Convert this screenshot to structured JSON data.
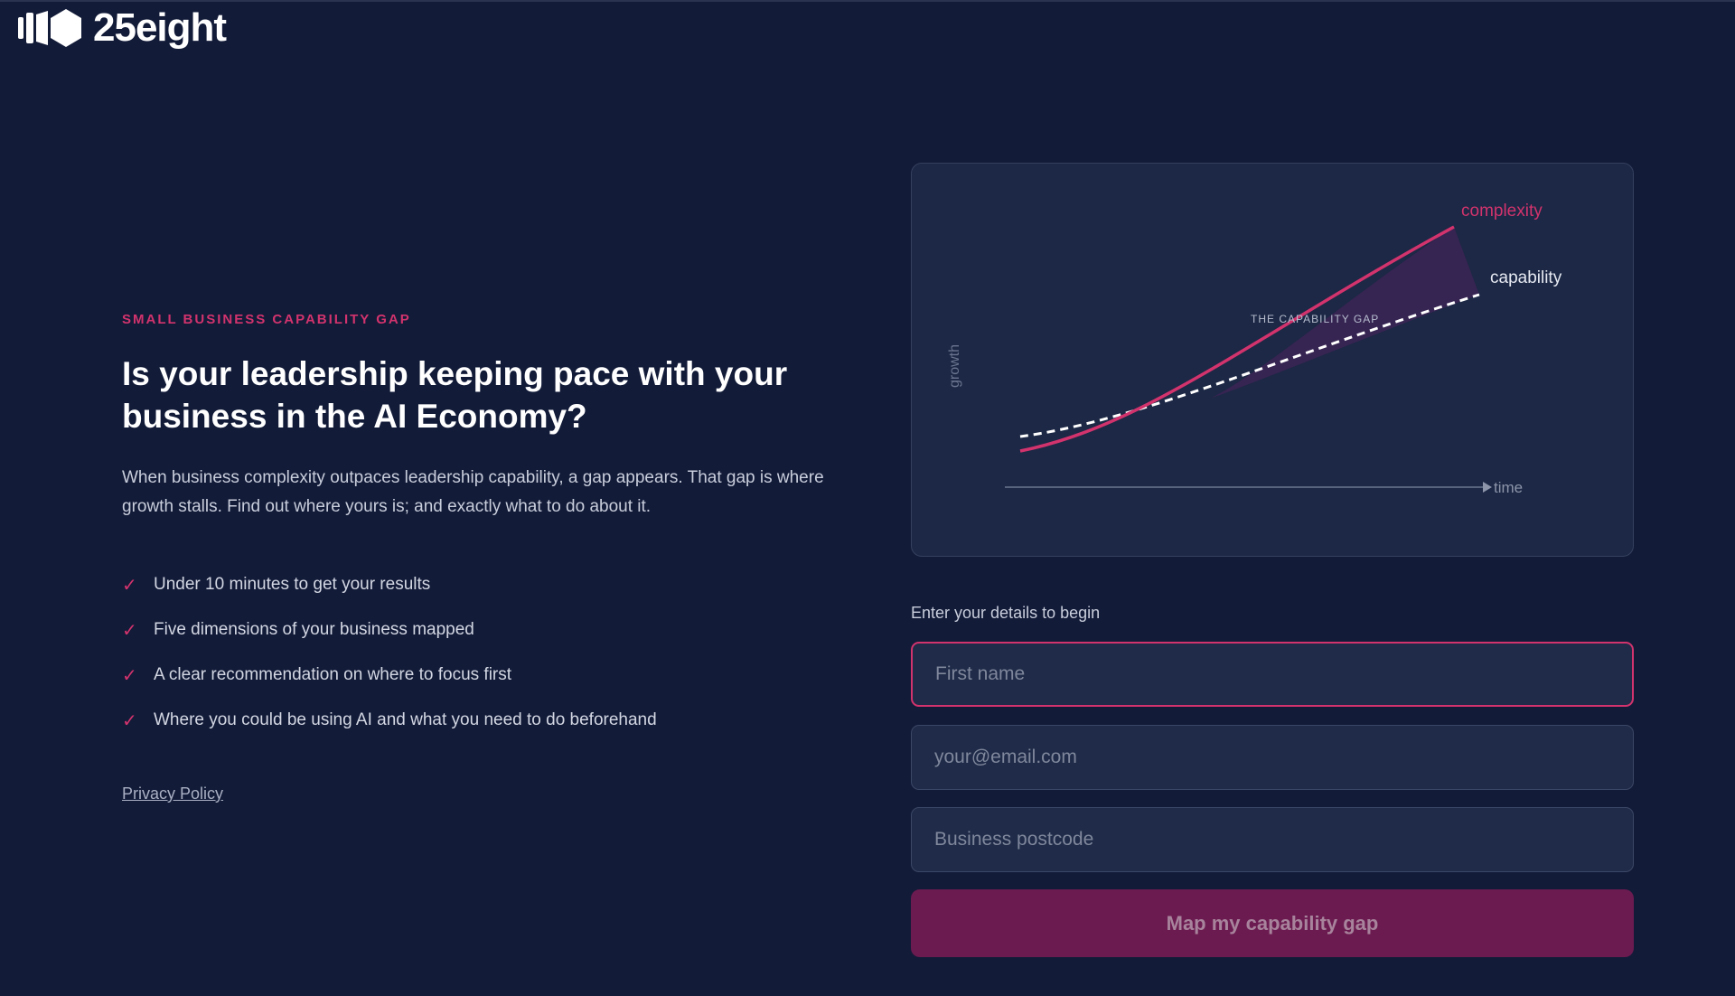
{
  "brand": {
    "name": "25eight"
  },
  "hero": {
    "eyebrow": "SMALL BUSINESS CAPABILITY GAP",
    "headline": "Is your leadership keeping pace with your business in the AI Economy?",
    "description": "When business complexity outpaces leadership capability, a gap appears. That gap is where growth stalls. Find out where yours is; and exactly what to do about it.",
    "features": [
      "Under 10 minutes to get your results",
      "Five dimensions of your business mapped",
      "A clear recommendation on where to focus first",
      "Where you could be using AI and what you need to do beforehand"
    ],
    "privacy_link": "Privacy Policy"
  },
  "illustration": {
    "y_label": "growth",
    "x_label": "time",
    "complexity_label": "complexity",
    "capability_label": "capability",
    "gap_label": "THE CAPABILITY GAP"
  },
  "form": {
    "title": "Enter your details to begin",
    "first_name_placeholder": "First name",
    "email_placeholder": "your@email.com",
    "postcode_placeholder": "Business postcode",
    "submit_label": "Map my capability gap"
  },
  "colors": {
    "background": "#121b38",
    "accent": "#d2336d",
    "card": "#1c2845",
    "button": "#6b1b50"
  }
}
